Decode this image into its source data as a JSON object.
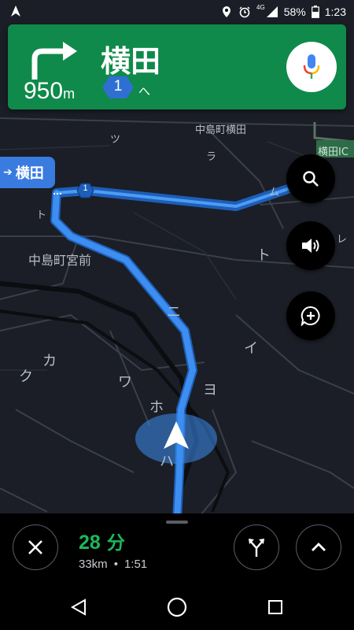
{
  "status_bar": {
    "network": "4G",
    "battery": "58%",
    "time": "1:23"
  },
  "direction": {
    "street": "横田",
    "distance_value": "950",
    "distance_unit": "m",
    "route_number": "1",
    "route_suffix": "へ"
  },
  "map": {
    "labels": [
      "中島町横田",
      "横田IC",
      "中島町宮前",
      "ツ",
      "ラ",
      "ム",
      "ト",
      "ト",
      "レ",
      "ニ",
      "イ",
      "カ",
      "ク",
      "ワ",
      "ホ",
      "ヨ",
      "ハ"
    ],
    "dest_callout": "横田",
    "route_marker": "1"
  },
  "eta": {
    "time_value": "28",
    "time_unit": "分",
    "distance": "33km",
    "separator": "•",
    "arrival": "1:51"
  },
  "colors": {
    "card_green": "#0f8a4a",
    "route_blue": "#3d8ef0",
    "eta_green": "#1db75a"
  },
  "icons": [
    "navigation-icon",
    "location-icon",
    "alarm-icon",
    "signal-icon",
    "battery-icon",
    "turn-right-icon",
    "mic-icon",
    "search-icon",
    "volume-icon",
    "add-report-icon",
    "close-icon",
    "alternate-routes-icon",
    "chevron-up-icon",
    "back-icon",
    "home-icon",
    "recents-icon"
  ]
}
